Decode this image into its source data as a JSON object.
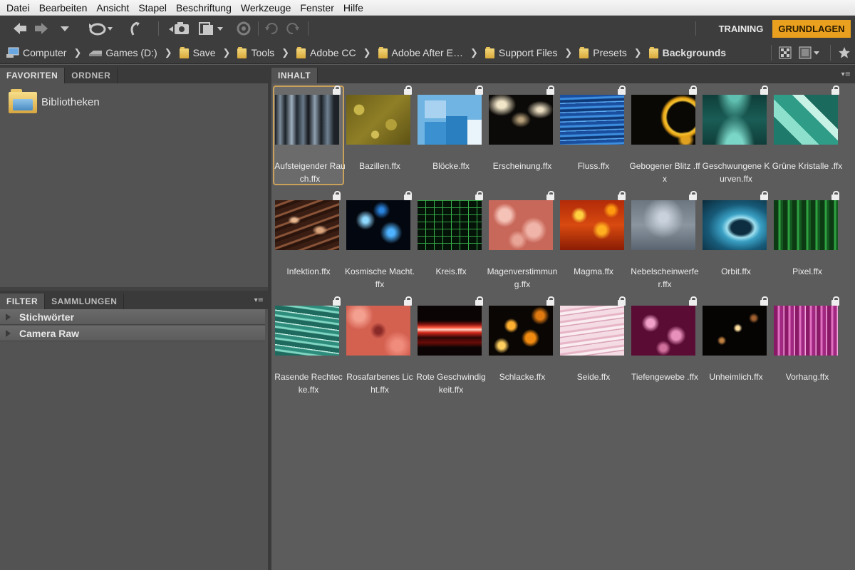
{
  "menu": [
    "Datei",
    "Bearbeiten",
    "Ansicht",
    "Stapel",
    "Beschriftung",
    "Werkzeuge",
    "Fenster",
    "Hilfe"
  ],
  "workspaces": {
    "training": "TRAINING",
    "grundlagen": "GRUNDLAGEN"
  },
  "colors": {
    "accent": "#e8a01e",
    "panel": "#535353",
    "content": "#5c5c5c",
    "selection": "#caa15a"
  },
  "path": {
    "computer": "Computer",
    "games": "Games (D:)",
    "save": "Save",
    "tools": "Tools",
    "adobecc": "Adobe CC",
    "afterfx": "Adobe After E…",
    "support": "Support Files",
    "presets": "Presets",
    "backgrounds": "Backgrounds"
  },
  "left": {
    "tabs": {
      "favoriten": "FAVORITEN",
      "ordner": "ORDNER"
    },
    "favorite": "Bibliotheken",
    "filter_tabs": {
      "filter": "FILTER",
      "sammlungen": "SAMMLUNGEN"
    },
    "filters": {
      "keywords": "Stichwörter",
      "camera_raw": "Camera Raw"
    }
  },
  "content": {
    "tab": "INHALT",
    "items": [
      {
        "name": "Aufsteigender Rauch.ffx",
        "selected": true
      },
      {
        "name": "Bazillen.ffx"
      },
      {
        "name": "Blöcke.ffx"
      },
      {
        "name": "Erscheinung.ffx"
      },
      {
        "name": "Fluss.ffx"
      },
      {
        "name": "Gebogener Blitz .ffx"
      },
      {
        "name": "Geschwungene Kurven.ffx"
      },
      {
        "name": "Grüne Kristalle .ffx"
      },
      {
        "name": "Infektion.ffx"
      },
      {
        "name": "Kosmische Macht.ffx"
      },
      {
        "name": "Kreis.ffx"
      },
      {
        "name": "Magenverstimmung.ffx"
      },
      {
        "name": "Magma.ffx"
      },
      {
        "name": "Nebelscheinwerfer.ffx"
      },
      {
        "name": "Orbit.ffx"
      },
      {
        "name": "Pixel.ffx"
      },
      {
        "name": "Rasende Rechtecke.ffx"
      },
      {
        "name": "Rosafarbenes Licht.ffx"
      },
      {
        "name": "Rote Geschwindigkeit.ffx"
      },
      {
        "name": "Schlacke.ffx"
      },
      {
        "name": "Seide.ffx"
      },
      {
        "name": "Tiefengewebe .ffx"
      },
      {
        "name": "Unheimlich.ffx"
      },
      {
        "name": "Vorhang.ffx"
      }
    ]
  }
}
